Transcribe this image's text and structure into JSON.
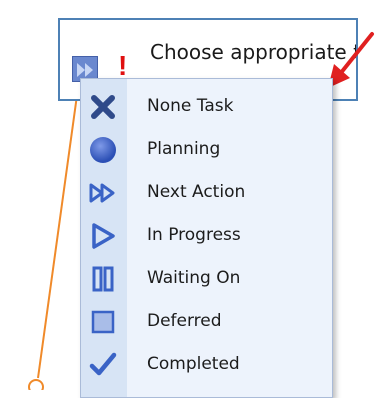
{
  "task": {
    "title": "Choose appropriate time",
    "priority_mark": "!",
    "status_icon": "next-action-icon"
  },
  "status_menu": {
    "items": [
      {
        "label": "None Task",
        "icon": "x-icon"
      },
      {
        "label": "Planning",
        "icon": "circle-icon"
      },
      {
        "label": "Next Action",
        "icon": "double-play-icon"
      },
      {
        "label": "In Progress",
        "icon": "play-icon"
      },
      {
        "label": "Waiting On",
        "icon": "pause-icon"
      },
      {
        "label": "Deferred",
        "icon": "square-icon"
      },
      {
        "label": "Completed",
        "icon": "checkmark-icon"
      }
    ]
  },
  "colors": {
    "icon_blue": "#3a63c6",
    "priority_red": "#e01010",
    "arrow_red": "#e02020",
    "connector_orange": "#f08a2a",
    "card_border": "#4d81b5",
    "menu_bg": "#edf3fc",
    "menu_gutter": "#d7e4f5"
  }
}
